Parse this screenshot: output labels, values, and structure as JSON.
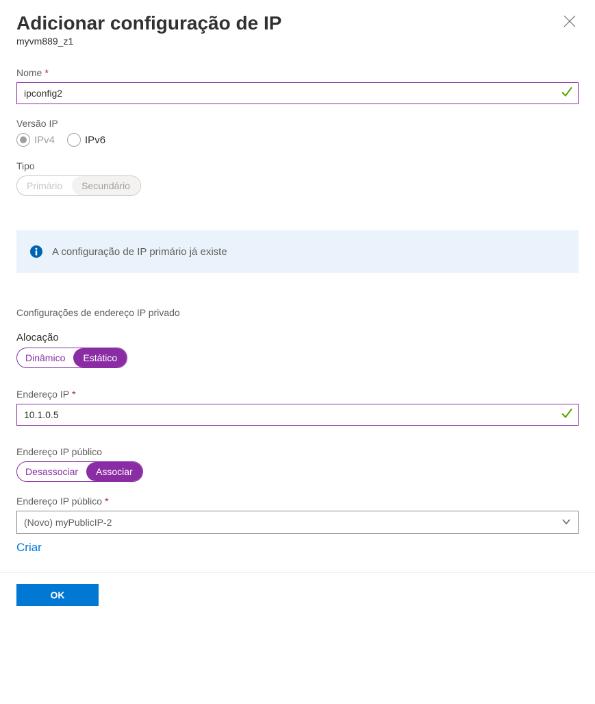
{
  "header": {
    "title": "Adicionar configuração de IP",
    "subtitle": "myvm889_z1"
  },
  "name": {
    "label": "Nome",
    "value": "ipconfig2"
  },
  "ip_version": {
    "label": "Versão IP",
    "ipv4": "IPv4",
    "ipv6": "IPv6"
  },
  "type": {
    "label": "Tipo",
    "primary": "Primário",
    "secondary": "Secundário"
  },
  "info": {
    "message": "A configuração de IP primário já existe"
  },
  "private_ip": {
    "section": "Configurações de endereço IP privado",
    "allocation_label": "Alocação",
    "dynamic": "Dinâmico",
    "static": "Estático",
    "address_label": "Endereço IP",
    "address_value": "10.1.0.5"
  },
  "public_ip": {
    "section": "Endereço IP público",
    "disassociate": "Desassociar",
    "associate": "Associar",
    "select_label": "Endereço IP público",
    "select_value": "(Novo) myPublicIP-2",
    "create": "Criar"
  },
  "footer": {
    "ok": "OK"
  }
}
